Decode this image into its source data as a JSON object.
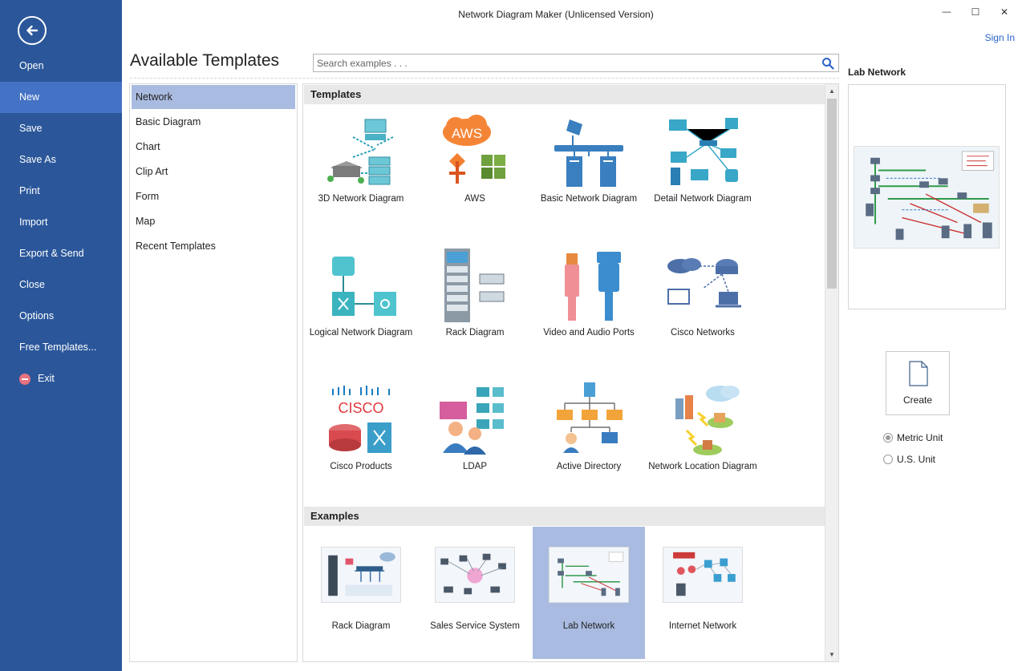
{
  "window": {
    "title": "Network Diagram Maker (Unlicensed Version)",
    "sign_in": "Sign In",
    "min_glyph": "—",
    "max_glyph": "☐",
    "close_glyph": "✕"
  },
  "nav": {
    "items": [
      {
        "label": "Open"
      },
      {
        "label": "New"
      },
      {
        "label": "Save"
      },
      {
        "label": "Save As"
      },
      {
        "label": "Print"
      },
      {
        "label": "Import"
      },
      {
        "label": "Export & Send"
      },
      {
        "label": "Close"
      },
      {
        "label": "Options"
      },
      {
        "label": "Free Templates..."
      },
      {
        "label": "Exit"
      }
    ],
    "active": "New"
  },
  "main": {
    "heading": "Available Templates",
    "search_placeholder": "Search examples . . ."
  },
  "categories": {
    "items": [
      {
        "label": "Network"
      },
      {
        "label": "Basic Diagram"
      },
      {
        "label": "Chart"
      },
      {
        "label": "Clip Art"
      },
      {
        "label": "Form"
      },
      {
        "label": "Map"
      },
      {
        "label": "Recent Templates"
      }
    ],
    "active": "Network"
  },
  "templates": {
    "header": "Templates",
    "items": [
      {
        "label": "3D Network Diagram",
        "icon": "3d-network-icon"
      },
      {
        "label": "AWS",
        "icon": "aws-icon"
      },
      {
        "label": "Basic Network Diagram",
        "icon": "basic-network-icon"
      },
      {
        "label": "Detail Network Diagram",
        "icon": "detail-network-icon"
      },
      {
        "label": "Logical Network Diagram",
        "icon": "logical-network-icon"
      },
      {
        "label": "Rack Diagram",
        "icon": "rack-icon"
      },
      {
        "label": "Video and Audio Ports",
        "icon": "ports-icon"
      },
      {
        "label": "Cisco Networks",
        "icon": "cisco-networks-icon"
      },
      {
        "label": "Cisco Products",
        "icon": "cisco-products-icon"
      },
      {
        "label": "LDAP",
        "icon": "ldap-icon"
      },
      {
        "label": "Active Directory",
        "icon": "active-directory-icon"
      },
      {
        "label": "Network Location Diagram",
        "icon": "network-location-icon"
      }
    ],
    "aws_text": "AWS",
    "cisco_text": "CISCO"
  },
  "examples": {
    "header": "Examples",
    "items": [
      {
        "label": "Rack Diagram"
      },
      {
        "label": "Sales Service System"
      },
      {
        "label": "Lab Network"
      },
      {
        "label": "Internet Network"
      }
    ],
    "selected": "Lab Network"
  },
  "preview": {
    "title": "Lab Network",
    "create_label": "Create",
    "units": [
      {
        "label": "Metric Unit",
        "checked": true
      },
      {
        "label": "U.S. Unit",
        "checked": false
      }
    ]
  },
  "colors": {
    "nav_bg": "#2b579a",
    "nav_active": "#4472c4",
    "selection": "#a9bbe0",
    "link": "#2a63c9"
  }
}
